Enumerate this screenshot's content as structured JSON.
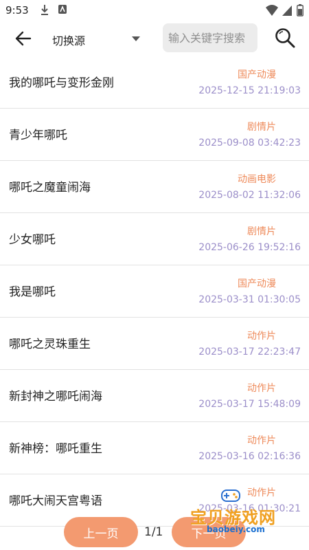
{
  "status_bar": {
    "time": "9:53"
  },
  "topbar": {
    "source_label": "切换源",
    "search_placeholder": "输入关键字搜索"
  },
  "list": [
    {
      "title": "我的哪吒与变形金刚",
      "category": "国产动漫",
      "date": "2025-12-15 21:19:03"
    },
    {
      "title": "青少年哪吒",
      "category": "剧情片",
      "date": "2025-09-08 03:42:23"
    },
    {
      "title": "哪吒之魔童闹海",
      "category": "动画电影",
      "date": "2025-08-02 11:32:06"
    },
    {
      "title": "少女哪吒",
      "category": "剧情片",
      "date": "2025-06-26 19:52:16"
    },
    {
      "title": "我是哪吒",
      "category": "国产动漫",
      "date": "2025-03-31 01:30:05"
    },
    {
      "title": "哪吒之灵珠重生",
      "category": "动作片",
      "date": "2025-03-17 22:23:47"
    },
    {
      "title": "新封神之哪吒闹海",
      "category": "动作片",
      "date": "2025-03-17 15:48:09"
    },
    {
      "title": "新神榜：哪吒重生",
      "category": "动作片",
      "date": "2025-03-16 02:16:36"
    },
    {
      "title": "哪吒大闹天宫粤语",
      "category": "动作片",
      "date": "2025-03-16 01:30:21"
    }
  ],
  "pager": {
    "prev_label": "上一页",
    "page_info": "1/1",
    "next_label": "下一页"
  },
  "watermark": {
    "text": "宝贝游戏网",
    "url": "baobeiy.com"
  }
}
